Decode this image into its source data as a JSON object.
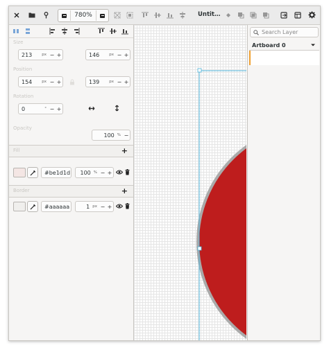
{
  "header": {
    "zoom": "780%",
    "doc_title": "Untit…",
    "icons": [
      "close-icon",
      "document-open-icon",
      "eyedropper-icon",
      "zoom-out-icon",
      "zoom-in-icon",
      "boolean-union-icon",
      "boolean-subtract-icon",
      "boolean-intersect-icon",
      "boolean-exclude-icon",
      "export-icon",
      "sidebar-toggle-icon",
      "settings-icon"
    ]
  },
  "left_panel": {
    "section_labels": {
      "size": "Size",
      "position": "Position",
      "rotation": "Rotation",
      "opacity": "Opacity",
      "fill": "Fill",
      "border": "Border"
    },
    "width": {
      "value": "213",
      "unit": "px"
    },
    "height": {
      "value": "146",
      "unit": "px"
    },
    "x": {
      "value": "154",
      "unit": "px"
    },
    "y": {
      "value": "139",
      "unit": "px"
    },
    "rotation": {
      "value": "0",
      "unit": "°"
    },
    "opacity": {
      "value": "100",
      "unit": "%",
      "level": 1.0
    },
    "fill": {
      "hex": "#be1d1d",
      "opacity": "100",
      "unit": "%",
      "swatch_color": "#f4e6e4"
    },
    "border": {
      "hex": "#aaaaaa",
      "width": "1",
      "unit": "px",
      "swatch_color": "#f0efed"
    },
    "plus_glyph": "+",
    "minus_glyph": "−",
    "plus_small": "+"
  },
  "canvas": {
    "shape_fill": "#be1d1d",
    "shape_border": "#aaaaaa",
    "selection_color": "#4fb3d9"
  },
  "right_panel": {
    "search_placeholder": "Search Layer",
    "artboard": "Artboard 0"
  }
}
